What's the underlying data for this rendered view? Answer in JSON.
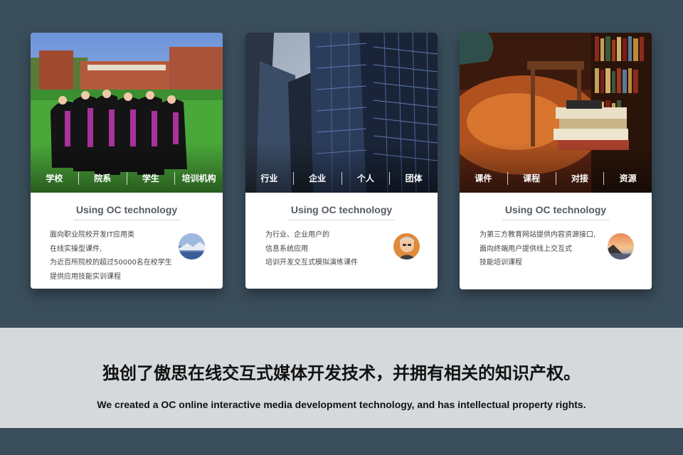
{
  "cards": [
    {
      "categories": [
        "学校",
        "院系",
        "学生",
        "培训机构"
      ],
      "title": "Using OC technology",
      "lines": [
        "面向职业院校开发IT应用类",
        "在线实操型课件,",
        "为近百所院校的超过50000名在校学生",
        "提供应用技能实训课程"
      ],
      "photo_icon": "graduation-photo",
      "avatar_icon": "landscape-avatar"
    },
    {
      "categories": [
        "行业",
        "企业",
        "个人",
        "团体"
      ],
      "title": "Using OC technology",
      "lines": [
        "为行业、企业用户的",
        "信息系统应用",
        "培训开发交互式模拟演练课件"
      ],
      "photo_icon": "skyscraper-photo",
      "avatar_icon": "person-avatar"
    },
    {
      "categories": [
        "课件",
        "课程",
        "对接",
        "资源"
      ],
      "title": "Using OC technology",
      "lines": [
        "为第三方教育网站提供内容资源接口,",
        "面向终端用户提供线上交互式",
        "技能培训课程"
      ],
      "photo_icon": "library-photo",
      "avatar_icon": "sunset-avatar"
    }
  ],
  "banner": {
    "zh": "独创了傲思在线交互式媒体开发技术，并拥有相关的知识产权。",
    "en": "We created a OC online interactive media development technology, and has intellectual property rights."
  },
  "colors": {
    "background": "#3a4d5b",
    "band": "#d5d9dc",
    "card": "#ffffff"
  }
}
